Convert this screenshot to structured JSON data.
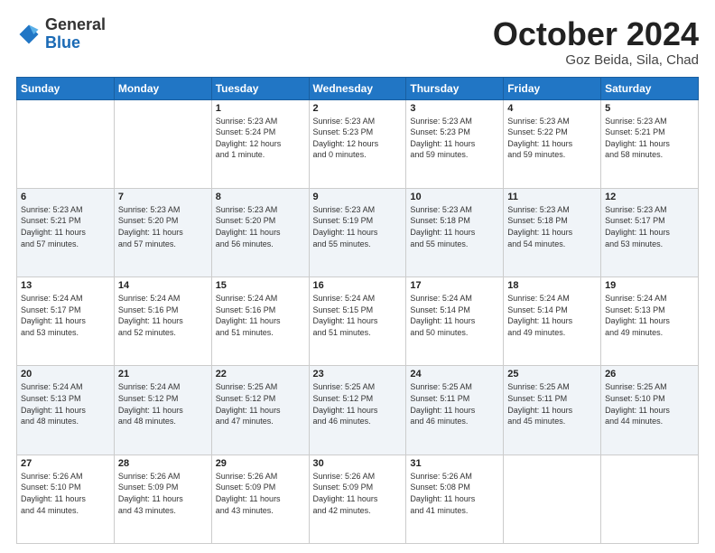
{
  "header": {
    "logo": {
      "general": "General",
      "blue": "Blue"
    },
    "title": "October 2024",
    "location": "Goz Beida, Sila, Chad"
  },
  "weekdays": [
    "Sunday",
    "Monday",
    "Tuesday",
    "Wednesday",
    "Thursday",
    "Friday",
    "Saturday"
  ],
  "weeks": [
    [
      {
        "day": "",
        "info": ""
      },
      {
        "day": "",
        "info": ""
      },
      {
        "day": "1",
        "info": "Sunrise: 5:23 AM\nSunset: 5:24 PM\nDaylight: 12 hours\nand 1 minute."
      },
      {
        "day": "2",
        "info": "Sunrise: 5:23 AM\nSunset: 5:23 PM\nDaylight: 12 hours\nand 0 minutes."
      },
      {
        "day": "3",
        "info": "Sunrise: 5:23 AM\nSunset: 5:23 PM\nDaylight: 11 hours\nand 59 minutes."
      },
      {
        "day": "4",
        "info": "Sunrise: 5:23 AM\nSunset: 5:22 PM\nDaylight: 11 hours\nand 59 minutes."
      },
      {
        "day": "5",
        "info": "Sunrise: 5:23 AM\nSunset: 5:21 PM\nDaylight: 11 hours\nand 58 minutes."
      }
    ],
    [
      {
        "day": "6",
        "info": "Sunrise: 5:23 AM\nSunset: 5:21 PM\nDaylight: 11 hours\nand 57 minutes."
      },
      {
        "day": "7",
        "info": "Sunrise: 5:23 AM\nSunset: 5:20 PM\nDaylight: 11 hours\nand 57 minutes."
      },
      {
        "day": "8",
        "info": "Sunrise: 5:23 AM\nSunset: 5:20 PM\nDaylight: 11 hours\nand 56 minutes."
      },
      {
        "day": "9",
        "info": "Sunrise: 5:23 AM\nSunset: 5:19 PM\nDaylight: 11 hours\nand 55 minutes."
      },
      {
        "day": "10",
        "info": "Sunrise: 5:23 AM\nSunset: 5:18 PM\nDaylight: 11 hours\nand 55 minutes."
      },
      {
        "day": "11",
        "info": "Sunrise: 5:23 AM\nSunset: 5:18 PM\nDaylight: 11 hours\nand 54 minutes."
      },
      {
        "day": "12",
        "info": "Sunrise: 5:23 AM\nSunset: 5:17 PM\nDaylight: 11 hours\nand 53 minutes."
      }
    ],
    [
      {
        "day": "13",
        "info": "Sunrise: 5:24 AM\nSunset: 5:17 PM\nDaylight: 11 hours\nand 53 minutes."
      },
      {
        "day": "14",
        "info": "Sunrise: 5:24 AM\nSunset: 5:16 PM\nDaylight: 11 hours\nand 52 minutes."
      },
      {
        "day": "15",
        "info": "Sunrise: 5:24 AM\nSunset: 5:16 PM\nDaylight: 11 hours\nand 51 minutes."
      },
      {
        "day": "16",
        "info": "Sunrise: 5:24 AM\nSunset: 5:15 PM\nDaylight: 11 hours\nand 51 minutes."
      },
      {
        "day": "17",
        "info": "Sunrise: 5:24 AM\nSunset: 5:14 PM\nDaylight: 11 hours\nand 50 minutes."
      },
      {
        "day": "18",
        "info": "Sunrise: 5:24 AM\nSunset: 5:14 PM\nDaylight: 11 hours\nand 49 minutes."
      },
      {
        "day": "19",
        "info": "Sunrise: 5:24 AM\nSunset: 5:13 PM\nDaylight: 11 hours\nand 49 minutes."
      }
    ],
    [
      {
        "day": "20",
        "info": "Sunrise: 5:24 AM\nSunset: 5:13 PM\nDaylight: 11 hours\nand 48 minutes."
      },
      {
        "day": "21",
        "info": "Sunrise: 5:24 AM\nSunset: 5:12 PM\nDaylight: 11 hours\nand 48 minutes."
      },
      {
        "day": "22",
        "info": "Sunrise: 5:25 AM\nSunset: 5:12 PM\nDaylight: 11 hours\nand 47 minutes."
      },
      {
        "day": "23",
        "info": "Sunrise: 5:25 AM\nSunset: 5:12 PM\nDaylight: 11 hours\nand 46 minutes."
      },
      {
        "day": "24",
        "info": "Sunrise: 5:25 AM\nSunset: 5:11 PM\nDaylight: 11 hours\nand 46 minutes."
      },
      {
        "day": "25",
        "info": "Sunrise: 5:25 AM\nSunset: 5:11 PM\nDaylight: 11 hours\nand 45 minutes."
      },
      {
        "day": "26",
        "info": "Sunrise: 5:25 AM\nSunset: 5:10 PM\nDaylight: 11 hours\nand 44 minutes."
      }
    ],
    [
      {
        "day": "27",
        "info": "Sunrise: 5:26 AM\nSunset: 5:10 PM\nDaylight: 11 hours\nand 44 minutes."
      },
      {
        "day": "28",
        "info": "Sunrise: 5:26 AM\nSunset: 5:09 PM\nDaylight: 11 hours\nand 43 minutes."
      },
      {
        "day": "29",
        "info": "Sunrise: 5:26 AM\nSunset: 5:09 PM\nDaylight: 11 hours\nand 43 minutes."
      },
      {
        "day": "30",
        "info": "Sunrise: 5:26 AM\nSunset: 5:09 PM\nDaylight: 11 hours\nand 42 minutes."
      },
      {
        "day": "31",
        "info": "Sunrise: 5:26 AM\nSunset: 5:08 PM\nDaylight: 11 hours\nand 41 minutes."
      },
      {
        "day": "",
        "info": ""
      },
      {
        "day": "",
        "info": ""
      }
    ]
  ]
}
